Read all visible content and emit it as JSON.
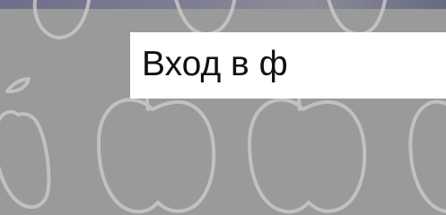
{
  "slide": {
    "title": "Вход в ф"
  },
  "colors": {
    "background": "#9a9a9a",
    "pattern_stroke": "#c8c8c8",
    "panel": "#ffffff",
    "text": "#111111"
  },
  "decoration": {
    "motif": "apple-outline-icon"
  }
}
